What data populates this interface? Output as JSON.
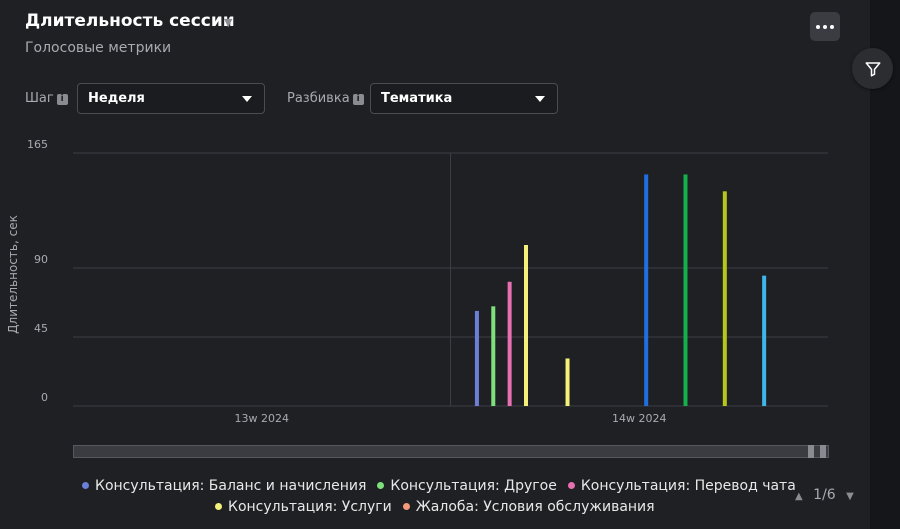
{
  "header": {
    "title": "Длительность сессии",
    "subtitle": "Голосовые метрики"
  },
  "controls": {
    "step_label": "Шаг",
    "step_value": "Неделя",
    "breakdown_label": "Разбивка",
    "breakdown_value": "Тематика",
    "info_glyph": "i"
  },
  "pager": {
    "text": "1/6"
  },
  "colors": {
    "background": "#1f2024",
    "grid": "#3c3e43",
    "text_muted": "#a8aab0"
  },
  "chart_data": {
    "type": "bar",
    "ylabel": "Длительность, сек",
    "ylim": [
      0,
      165
    ],
    "yticks": [
      0,
      45,
      90,
      165
    ],
    "categories": [
      "13w 2024",
      "14w 2024"
    ],
    "grid": true,
    "legend_position": "bottom",
    "series": [
      {
        "name": "Консультация: Баланс и начисления",
        "color": "#6b7fd6",
        "values": [
          62,
          0
        ]
      },
      {
        "name": "Консультация: Другое",
        "color": "#7ee07a",
        "values": [
          65,
          0
        ]
      },
      {
        "name": "Консультация: Перевод чата",
        "color": "#e86fb0",
        "values": [
          81,
          0
        ]
      },
      {
        "name": "Консультация: Услуги",
        "color": "#f5f07a",
        "values": [
          105,
          31
        ]
      },
      {
        "name": "Жалоба: Условия обслуживания",
        "color": "#f29a7a",
        "values": [
          0,
          0
        ]
      },
      {
        "name": "",
        "color": "#1f6fe0",
        "values": [
          0,
          151
        ]
      },
      {
        "name": "",
        "color": "#14b04a",
        "values": [
          0,
          151
        ]
      },
      {
        "name": "",
        "color": "#b5c81a",
        "values": [
          0,
          140
        ]
      },
      {
        "name": "",
        "color": "#3fb6ea",
        "values": [
          0,
          85
        ]
      }
    ]
  }
}
